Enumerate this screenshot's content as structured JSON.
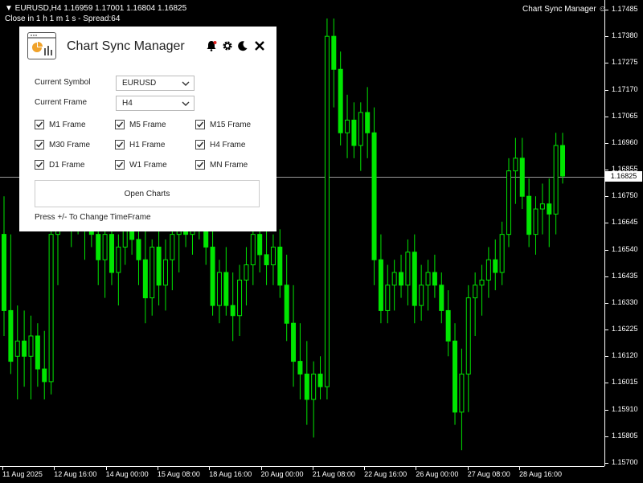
{
  "chart_info": {
    "line1": "▼ EURUSD,H4  1.16959 1.17001 1.16804 1.16825",
    "line2": "Close in 1 h 1 m 1 s - Spread:64",
    "indicator_name": "Chart Sync Manager ☺"
  },
  "colors": {
    "candle": "#00e600",
    "background": "#000000",
    "axis": "#ffffff",
    "bid_line": "#9a9a9a"
  },
  "chart_data": {
    "type": "candlestick",
    "symbol": "EURUSD",
    "timeframe": "H4",
    "current_price": "1.16825",
    "price_ticks": [
      "1.17485",
      "1.17380",
      "1.17275",
      "1.17170",
      "1.17065",
      "1.16960",
      "1.16855",
      "1.16750",
      "1.16645",
      "1.16540",
      "1.16435",
      "1.16330",
      "1.16225",
      "1.16120",
      "1.16015",
      "1.15910",
      "1.15805",
      "1.15700"
    ],
    "time_labels": [
      "11 Aug 2025",
      "12 Aug 16:00",
      "14 Aug 00:00",
      "15 Aug 08:00",
      "18 Aug 16:00",
      "20 Aug 00:00",
      "21 Aug 08:00",
      "22 Aug 16:00",
      "26 Aug 00:00",
      "27 Aug 08:00",
      "28 Aug 16:00"
    ],
    "ylim": [
      1.157,
      1.17485
    ],
    "candles": [
      [
        1.166,
        1.1675,
        1.162,
        1.163
      ],
      [
        1.163,
        1.166,
        1.1605,
        1.161
      ],
      [
        1.1612,
        1.1632,
        1.1595,
        1.1618
      ],
      [
        1.1618,
        1.163,
        1.16,
        1.1612
      ],
      [
        1.1612,
        1.1628,
        1.1595,
        1.162
      ],
      [
        1.162,
        1.1625,
        1.16,
        1.1607
      ],
      [
        1.1607,
        1.1622,
        1.1595,
        1.1602
      ],
      [
        1.1602,
        1.1665,
        1.1597,
        1.166
      ],
      [
        1.166,
        1.169,
        1.164,
        1.168
      ],
      [
        1.168,
        1.17,
        1.1662,
        1.167
      ],
      [
        1.167,
        1.1695,
        1.1655,
        1.1675
      ],
      [
        1.1675,
        1.169,
        1.166,
        1.1665
      ],
      [
        1.1665,
        1.168,
        1.165,
        1.167
      ],
      [
        1.167,
        1.169,
        1.1655,
        1.166
      ],
      [
        1.166,
        1.1675,
        1.164,
        1.165
      ],
      [
        1.165,
        1.1668,
        1.1635,
        1.166
      ],
      [
        1.166,
        1.1675,
        1.164,
        1.1645
      ],
      [
        1.1645,
        1.166,
        1.1632,
        1.1655
      ],
      [
        1.1655,
        1.1675,
        1.1648,
        1.1665
      ],
      [
        1.1665,
        1.168,
        1.1652,
        1.1658
      ],
      [
        1.1658,
        1.1668,
        1.164,
        1.165
      ],
      [
        1.165,
        1.1665,
        1.1625,
        1.1635
      ],
      [
        1.1635,
        1.1658,
        1.1628,
        1.1655
      ],
      [
        1.1655,
        1.167,
        1.1632,
        1.164
      ],
      [
        1.164,
        1.1658,
        1.163,
        1.165
      ],
      [
        1.165,
        1.167,
        1.1638,
        1.166
      ],
      [
        1.166,
        1.1675,
        1.1645,
        1.1668
      ],
      [
        1.1668,
        1.168,
        1.1655,
        1.166
      ],
      [
        1.166,
        1.168,
        1.1652,
        1.1675
      ],
      [
        1.1675,
        1.169,
        1.1658,
        1.1665
      ],
      [
        1.1665,
        1.1678,
        1.1648,
        1.1655
      ],
      [
        1.1655,
        1.1665,
        1.1628,
        1.1632
      ],
      [
        1.1632,
        1.165,
        1.1625,
        1.1645
      ],
      [
        1.1645,
        1.1655,
        1.1628,
        1.1632
      ],
      [
        1.1632,
        1.1645,
        1.1618,
        1.1628
      ],
      [
        1.1628,
        1.1648,
        1.162,
        1.1642
      ],
      [
        1.1642,
        1.1655,
        1.1632,
        1.1648
      ],
      [
        1.1648,
        1.1665,
        1.164,
        1.166
      ],
      [
        1.166,
        1.1675,
        1.1645,
        1.1652
      ],
      [
        1.1652,
        1.1665,
        1.164,
        1.1648
      ],
      [
        1.1648,
        1.166,
        1.164,
        1.1655
      ],
      [
        1.1655,
        1.1662,
        1.1635,
        1.164
      ],
      [
        1.164,
        1.1652,
        1.1618,
        1.1625
      ],
      [
        1.1625,
        1.164,
        1.16,
        1.161
      ],
      [
        1.161,
        1.1625,
        1.1595,
        1.1605
      ],
      [
        1.1605,
        1.1618,
        1.1585,
        1.1595
      ],
      [
        1.1595,
        1.161,
        1.158,
        1.1605
      ],
      [
        1.1605,
        1.1612,
        1.1595,
        1.16
      ],
      [
        1.16,
        1.1745,
        1.1595,
        1.1738
      ],
      [
        1.1738,
        1.1745,
        1.171,
        1.1725
      ],
      [
        1.1725,
        1.1732,
        1.1695,
        1.17
      ],
      [
        1.17,
        1.1715,
        1.169,
        1.1705
      ],
      [
        1.1705,
        1.1712,
        1.169,
        1.1695
      ],
      [
        1.1695,
        1.1712,
        1.1685,
        1.1708
      ],
      [
        1.1708,
        1.1718,
        1.169,
        1.17
      ],
      [
        1.17,
        1.171,
        1.164,
        1.165
      ],
      [
        1.165,
        1.166,
        1.1625,
        1.163
      ],
      [
        1.163,
        1.1648,
        1.1625,
        1.164
      ],
      [
        1.164,
        1.165,
        1.163,
        1.1645
      ],
      [
        1.1645,
        1.1652,
        1.1635,
        1.164
      ],
      [
        1.164,
        1.1658,
        1.1632,
        1.1653
      ],
      [
        1.1653,
        1.166,
        1.1625,
        1.1632
      ],
      [
        1.1632,
        1.1648,
        1.1626,
        1.164
      ],
      [
        1.164,
        1.165,
        1.163,
        1.1645
      ],
      [
        1.1645,
        1.1652,
        1.1635,
        1.164
      ],
      [
        1.164,
        1.1645,
        1.1625,
        1.163
      ],
      [
        1.163,
        1.1638,
        1.1612,
        1.1618
      ],
      [
        1.1618,
        1.1625,
        1.1585,
        1.159
      ],
      [
        1.159,
        1.1615,
        1.1575,
        1.1605
      ],
      [
        1.1605,
        1.164,
        1.159,
        1.1635
      ],
      [
        1.1635,
        1.1645,
        1.162,
        1.164
      ],
      [
        1.164,
        1.1648,
        1.1628,
        1.1642
      ],
      [
        1.1642,
        1.1655,
        1.1635,
        1.165
      ],
      [
        1.165,
        1.1658,
        1.1638,
        1.1645
      ],
      [
        1.1645,
        1.1665,
        1.164,
        1.166
      ],
      [
        1.166,
        1.169,
        1.1655,
        1.1685
      ],
      [
        1.1685,
        1.1698,
        1.1672,
        1.169
      ],
      [
        1.169,
        1.1698,
        1.167,
        1.1675
      ],
      [
        1.1675,
        1.1682,
        1.1655,
        1.166
      ],
      [
        1.166,
        1.1675,
        1.1652,
        1.167
      ],
      [
        1.167,
        1.168,
        1.166,
        1.1672
      ],
      [
        1.1672,
        1.1682,
        1.1655,
        1.1668
      ],
      [
        1.1668,
        1.17,
        1.166,
        1.1695
      ],
      [
        1.1695,
        1.17,
        1.168,
        1.1683
      ]
    ]
  },
  "panel": {
    "title": "Chart Sync Manager",
    "current_symbol_label": "Current Symbol",
    "current_symbol_value": "EURUSD",
    "current_frame_label": "Current Frame",
    "current_frame_value": "H4",
    "frames": [
      {
        "label": "M1 Frame",
        "checked": true
      },
      {
        "label": "M5 Frame",
        "checked": true
      },
      {
        "label": "M15 Frame",
        "checked": true
      },
      {
        "label": "M30 Frame",
        "checked": true
      },
      {
        "label": "H1 Frame",
        "checked": true
      },
      {
        "label": "H4 Frame",
        "checked": true
      },
      {
        "label": "D1 Frame",
        "checked": true
      },
      {
        "label": "W1 Frame",
        "checked": true
      },
      {
        "label": "MN Frame",
        "checked": true
      }
    ],
    "open_button": "Open Charts",
    "hint": "Press  +/-  To Change TimeFrame",
    "icons": [
      "alert-icon",
      "gear-icon",
      "moon-icon",
      "close-icon"
    ]
  }
}
